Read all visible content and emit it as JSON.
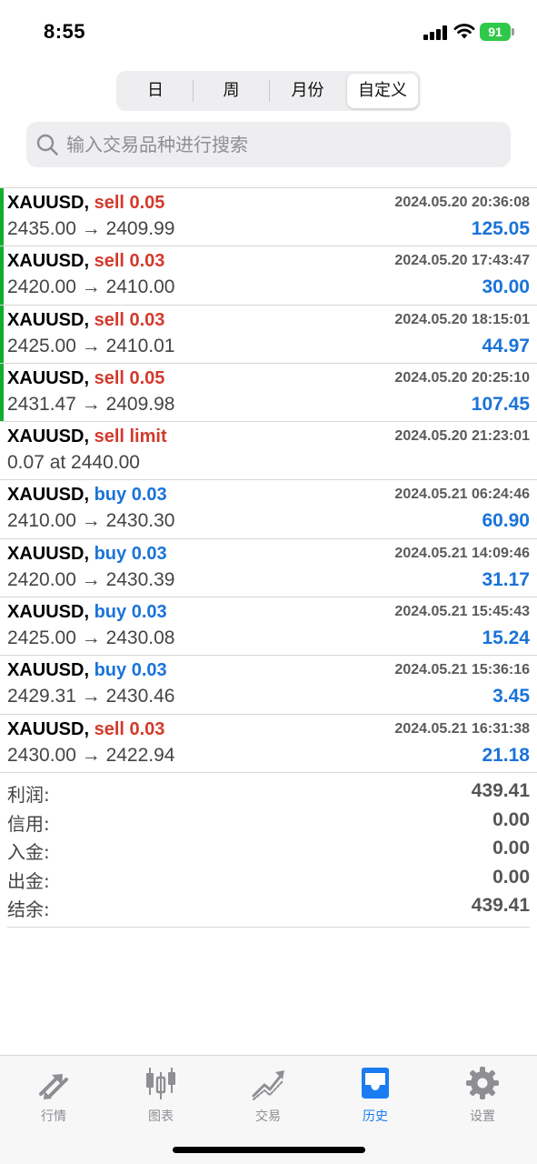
{
  "status_bar": {
    "time": "8:55",
    "battery": "91",
    "icons": [
      "signal-icon",
      "wifi-icon",
      "battery-icon"
    ]
  },
  "period_tabs": {
    "selected": "自定义",
    "items": [
      {
        "label": "日"
      },
      {
        "label": "周"
      },
      {
        "label": "月份"
      },
      {
        "label": "自定义"
      }
    ]
  },
  "search": {
    "placeholder": "输入交易品种进行搜索",
    "value": ""
  },
  "deals": [
    {
      "symbol": "XAUUSD,",
      "side": "sell 0.05",
      "side_type": "sell",
      "time": "2024.05.20 20:36:08",
      "prices": "2435.00 → 2409.99",
      "profit": "125.05"
    },
    {
      "symbol": "XAUUSD,",
      "side": "sell 0.03",
      "side_type": "sell",
      "time": "2024.05.20 17:43:47",
      "prices": "2420.00 → 2410.00",
      "profit": "30.00"
    },
    {
      "symbol": "XAUUSD,",
      "side": "sell 0.03",
      "side_type": "sell",
      "time": "2024.05.20 18:15:01",
      "prices": "2425.00 → 2410.01",
      "profit": "44.97"
    },
    {
      "symbol": "XAUUSD,",
      "side": "sell 0.05",
      "side_type": "sell",
      "time": "2024.05.20 20:25:10",
      "prices": "2431.47 → 2409.98",
      "profit": "107.45"
    },
    {
      "symbol": "XAUUSD,",
      "side": "sell limit",
      "side_type": "sell",
      "time": "2024.05.20 21:23:01",
      "prices": "0.07 at 2440.00",
      "profit": ""
    },
    {
      "symbol": "XAUUSD,",
      "side": "buy 0.03",
      "side_type": "buy",
      "time": "2024.05.21 06:24:46",
      "prices": "2410.00 → 2430.30",
      "profit": "60.90"
    },
    {
      "symbol": "XAUUSD,",
      "side": "buy 0.03",
      "side_type": "buy",
      "time": "2024.05.21 14:09:46",
      "prices": "2420.00 → 2430.39",
      "profit": "31.17"
    },
    {
      "symbol": "XAUUSD,",
      "side": "buy 0.03",
      "side_type": "buy",
      "time": "2024.05.21 15:45:43",
      "prices": "2425.00 → 2430.08",
      "profit": "15.24"
    },
    {
      "symbol": "XAUUSD,",
      "side": "buy 0.03",
      "side_type": "buy",
      "time": "2024.05.21 15:36:16",
      "prices": "2429.31 → 2430.46",
      "profit": "3.45"
    },
    {
      "symbol": "XAUUSD,",
      "side": "sell 0.03",
      "side_type": "sell",
      "time": "2024.05.21 16:31:38",
      "prices": "2430.00 → 2422.94",
      "profit": "21.18"
    }
  ],
  "summary": [
    {
      "label": "利润:",
      "value": "439.41"
    },
    {
      "label": "信用:",
      "value": "0.00"
    },
    {
      "label": "入金:",
      "value": "0.00"
    },
    {
      "label": "出金:",
      "value": "0.00"
    },
    {
      "label": "结余:",
      "value": "439.41"
    }
  ],
  "tabbar": {
    "active": "历史",
    "items": [
      {
        "label": "行情",
        "icon": "quotes-arrows-icon"
      },
      {
        "label": "图表",
        "icon": "candlestick-chart-icon"
      },
      {
        "label": "交易",
        "icon": "trade-trend-icon"
      },
      {
        "label": "历史",
        "icon": "history-inbox-icon"
      },
      {
        "label": "设置",
        "icon": "settings-gear-icon"
      }
    ]
  },
  "colors": {
    "sell": "#d23a2c",
    "buy": "#1a73d9",
    "profit": "#1a73d9",
    "open_marker": "#13ad2c",
    "active_tab": "#1a7cf0",
    "battery": "#30c84a"
  }
}
